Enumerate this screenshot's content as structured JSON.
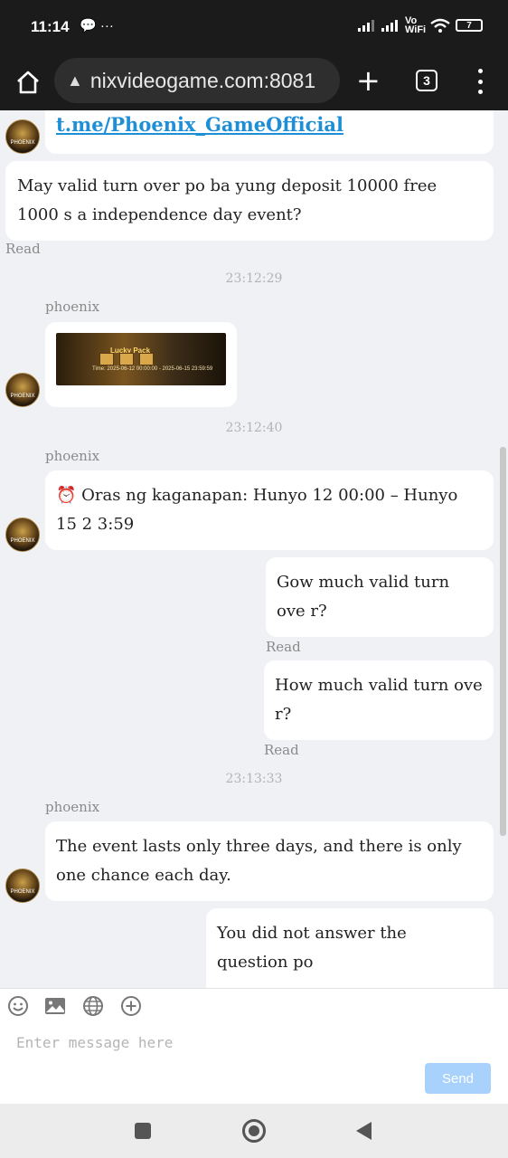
{
  "status_bar": {
    "time": "11:14",
    "left_icons": "💬 ···",
    "network": "Vo WiFi",
    "battery": "7"
  },
  "browser": {
    "url": "nixvideogame.com:8081",
    "tab_count": "3"
  },
  "chat": {
    "messages": [
      {
        "type": "link",
        "text": "t.me/Phoenix_GameOfficial"
      },
      {
        "type": "outgoing",
        "text": "May valid turn over po ba yung deposit 10000 free 1000 s a independence day event?",
        "status": "Read"
      },
      {
        "type": "timestamp",
        "text": "23:12:29"
      },
      {
        "type": "incoming_image",
        "sender": "phoenix",
        "image_title": "Lucky Pack",
        "image_caption": "Time: 2025-06-12 00:00:00 - 2025-06-15 23:59:59"
      },
      {
        "type": "timestamp",
        "text": "23:12:40"
      },
      {
        "type": "incoming",
        "sender": "phoenix",
        "text": "⏰ Oras ng kaganapan: Hunyo 12 00:00 – Hunyo 15 2 3:59"
      },
      {
        "type": "outgoing",
        "text": "Gow much valid turn ove r?",
        "status": "Read"
      },
      {
        "type": "outgoing",
        "text": "How much valid turn ove r?",
        "status": "Read"
      },
      {
        "type": "timestamp",
        "text": "23:13:33"
      },
      {
        "type": "incoming",
        "sender": "phoenix",
        "text": "The event lasts only three days, and there is only one chance each day."
      },
      {
        "type": "outgoing",
        "text": "You did not answer the question po"
      }
    ],
    "avatar_label": "PHOENIX"
  },
  "composer": {
    "placeholder": "Enter message here",
    "send_label": "Send",
    "tools": [
      "emoji-icon",
      "image-icon",
      "globe-icon",
      "plus-circle-icon"
    ]
  },
  "colors": {
    "link": "#1e8fd6",
    "send_button": "#a8d2fb",
    "chat_background": "#f0f1f5"
  }
}
